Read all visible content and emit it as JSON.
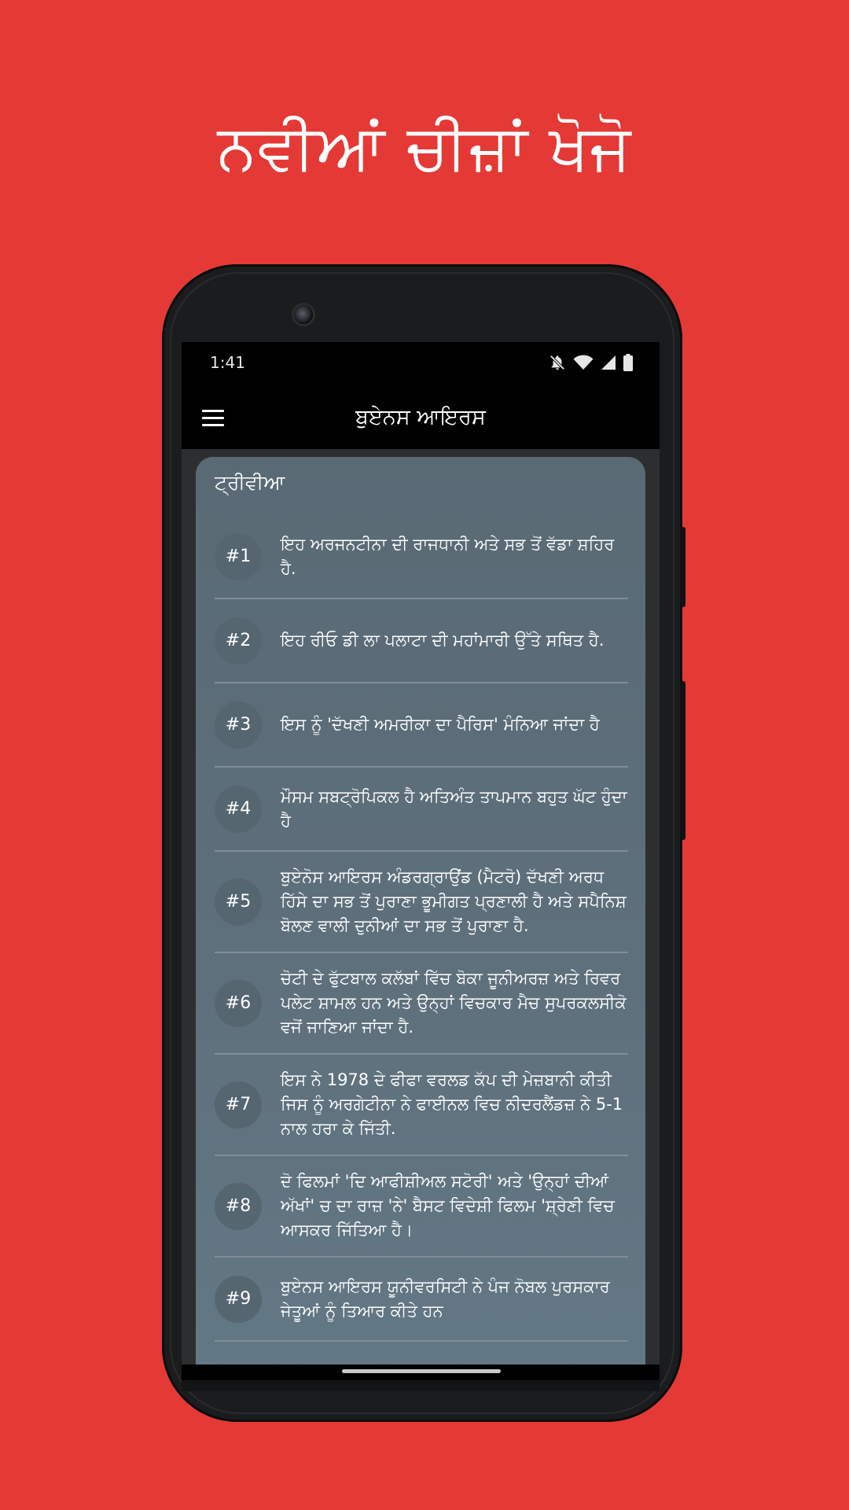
{
  "promo": {
    "headline": "ਨਵੀਆਂ ਚੀਜ਼ਾਂ ਖੋਜੋ"
  },
  "status_bar": {
    "time": "1:41",
    "icons": [
      "bell-off-icon",
      "wifi-icon",
      "signal-icon",
      "battery-icon"
    ]
  },
  "app_bar": {
    "title": "ਬੁਏਨਸ ਆਇਰਸ",
    "menu_icon": "hamburger-menu-icon"
  },
  "card": {
    "title": "ਟ੍ਰੀਵੀਆ",
    "items": [
      {
        "num": "#1",
        "text": "ਇਹ ਅਰਜਨਟੀਨਾ ਦੀ ਰਾਜਧਾਨੀ ਅਤੇ ਸਭ ਤੋਂ ਵੱਡਾ ਸ਼ਹਿਰ ਹੈ."
      },
      {
        "num": "#2",
        "text": "ਇਹ ਰੀਓ ਡੀ ਲਾ ਪਲਾਟਾ ਦੀ ਮਹਾਂਮਾਰੀ ਉੱਤੇ ਸਥਿਤ ਹੈ."
      },
      {
        "num": "#3",
        "text": "ਇਸ ਨੂੰ 'ਦੱਖਣੀ ਅਮਰੀਕਾ ਦਾ ਪੈਰਿਸ' ਮੰਨਿਆ ਜਾਂਦਾ ਹੈ"
      },
      {
        "num": "#4",
        "text": "ਮੌਸਮ ਸਬਟ੍ਰੋਪਿਕਲ ਹੈ ਅਤਿਅੰਤ ਤਾਪਮਾਨ ਬਹੁਤ ਘੱਟ ਹੁੰਦਾ ਹੈ"
      },
      {
        "num": "#5",
        "text": "ਬੁਏਨੋਸ ਆਇਰਸ ਅੰਡਰਗ੍ਰਾਉਂਡ (ਮੈਟਰੋ) ਦੱਖਣੀ ਅਰਧ ਹਿੱਸੇ ਦਾ ਸਭ ਤੋਂ ਪੁਰਾਣਾ ਭੂਮੀਗਤ ਪ੍ਰਣਾਲੀ ਹੈ ਅਤੇ ਸਪੈਨਿਸ਼ ਬੋਲਣ ਵਾਲੀ ਦੁਨੀਆਂ ਦਾ ਸਭ ਤੋਂ ਪੁਰਾਣਾ ਹੈ."
      },
      {
        "num": "#6",
        "text": "ਚੋਟੀ ਦੇ ਫੁੱਟਬਾਲ ਕਲੱਬਾਂ ਵਿੱਚ ਬੋਕਾ ਜੂਨੀਅਰਜ਼ ਅਤੇ ਰਿਵਰ ਪਲੇਟ ਸ਼ਾਮਲ ਹਨ ਅਤੇ ਉਨ੍ਹਾਂ ਵਿਚਕਾਰ ਮੈਚ ਸੁਪਰਕਲਸੀਕੋ ਵਜੋਂ ਜਾਣਿਆ ਜਾਂਦਾ ਹੈ."
      },
      {
        "num": "#7",
        "text": "ਇਸ ਨੇ 1978 ਦੇ ਫੀਫਾ ਵਰਲਡ ਕੱਪ ਦੀ ਮੇਜ਼ਬਾਨੀ ਕੀਤੀ ਜਿਸ ਨੂੰ ਅਰਗੇਟੀਨਾ ਨੇ ਫਾਈਨਲ ਵਿਚ ਨੀਦਰਲੈਂਡਜ਼ ਨੇ 5-1 ਨਾਲ ਹਰਾ ਕੇ ਜਿੱਤੀ."
      },
      {
        "num": "#8",
        "text": "ਦੋ ਫਿਲਮਾਂ 'ਦਿ ਆਫੀਸ਼ੀਅਲ ਸਟੋਰੀ' ਅਤੇ 'ਉਨ੍ਹਾਂ ਦੀਆਂ ਅੱਖਾਂ' ਚ ਦਾ ਰਾਜ਼ 'ਨੇ' ਬੈਸਟ ਵਿਦੇਸ਼ੀ ਫਿਲਮ 'ਸ਼੍ਰੇਣੀ ਵਿਚ ਆਸਕਰ ਜਿੱਤਿਆ ਹੈ।"
      },
      {
        "num": "#9",
        "text": "ਬੁਏਨਸ ਆਇਰਸ ਯੂਨੀਵਰਸਿਟੀ ਨੇ ਪੰਜ ਨੋਬਲ ਪੁਰਸਕਾਰ ਜੇਤੂਆਂ ਨੂੰ ਤਿਆਰ ਕੀਤੇ ਹਨ"
      }
    ]
  }
}
